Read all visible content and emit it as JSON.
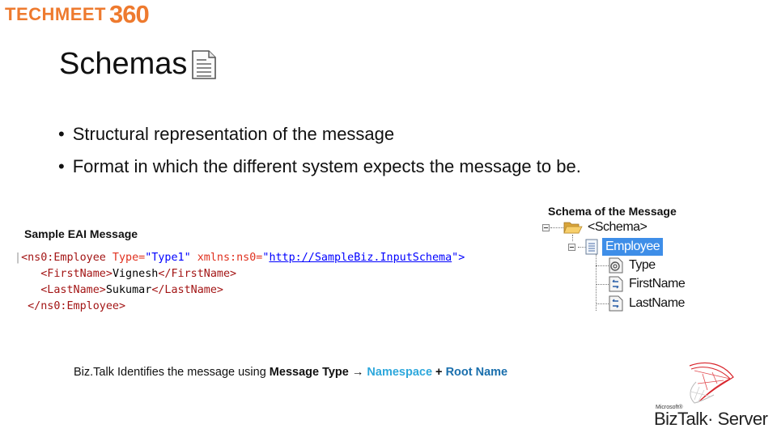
{
  "brand": {
    "name": "TECHMEET",
    "number": "360",
    "color": "#ee7a2e"
  },
  "slide": {
    "title": "Schemas",
    "title_icon": "document-icon",
    "bullets": [
      "Structural representation of the message",
      "Format in which the different system expects the message to be."
    ]
  },
  "sample": {
    "caption": "Sample EAI  Message",
    "lines": {
      "l1_open": "<ns0:Employee",
      "l1_attr1": " Type=",
      "l1_val1": "\"Type1\"",
      "l1_attr2": " xmlns:ns0=",
      "l1_q1": "\"",
      "l1_url": "http://SampleBiz.InputSchema",
      "l1_q2": "\">",
      "l2_open": "<FirstName>",
      "l2_text": "Vignesh",
      "l2_close": "</FirstName>",
      "l3_open": "<LastName>",
      "l3_text": "Sukumar",
      "l3_close": "</LastName>",
      "l4_close": "</ns0:Employee>"
    }
  },
  "schema_tree": {
    "caption": "Schema of the Message",
    "root": {
      "label": "<Schema>",
      "icon": "folder-open-icon"
    },
    "record": {
      "label": "Employee",
      "icon": "record-icon",
      "selected": true
    },
    "children": [
      {
        "label": "Type",
        "icon": "attribute-icon"
      },
      {
        "label": "FirstName",
        "icon": "element-icon"
      },
      {
        "label": "LastName",
        "icon": "element-icon"
      }
    ],
    "selection_color": "#3e8ee8"
  },
  "footer": {
    "prefix": "Biz.Talk Identifies the message using ",
    "message_type": "Message Type",
    "arrow": "→",
    "namespace": "Namespace",
    "plus": " + ",
    "root_name": "Root Name",
    "namespace_color": "#2ea8dc",
    "root_name_color": "#1a6fad"
  },
  "product_logo": {
    "vendor": "Microsoft®",
    "name": "BizTalk· Server"
  }
}
